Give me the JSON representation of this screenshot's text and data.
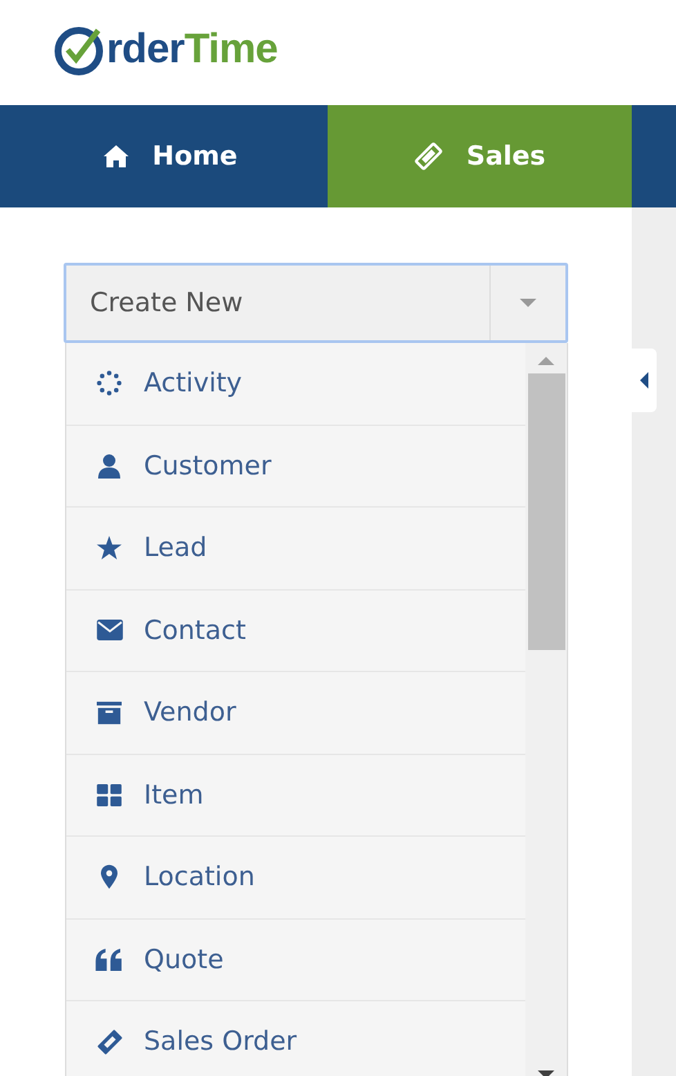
{
  "logo": {
    "part_1": "rder",
    "part_2": "Time"
  },
  "nav": [
    {
      "label": "Home",
      "selected": false
    },
    {
      "label": "Sales",
      "selected": true
    }
  ],
  "create_menu": {
    "label": "Create New",
    "items": [
      {
        "label": "Activity"
      },
      {
        "label": "Customer"
      },
      {
        "label": "Lead"
      },
      {
        "label": "Contact"
      },
      {
        "label": "Vendor"
      },
      {
        "label": "Item"
      },
      {
        "label": "Location"
      },
      {
        "label": "Quote"
      },
      {
        "label": "Sales Order"
      }
    ]
  }
}
